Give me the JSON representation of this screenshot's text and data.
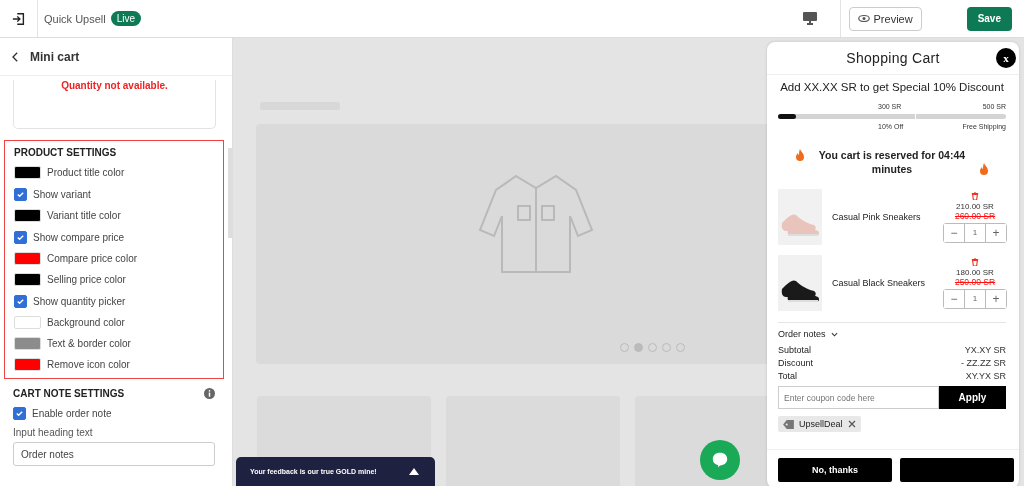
{
  "topbar": {
    "app_name": "Quick Upsell",
    "status_badge": "Live",
    "preview_button": "Preview",
    "save_button": "Save"
  },
  "sidebar": {
    "back_title": "Mini cart",
    "error_preview": "Quantity not available.",
    "product_settings": {
      "heading": "PRODUCT SETTINGS",
      "items": [
        {
          "kind": "color",
          "label": "Product title color",
          "color": "#000000"
        },
        {
          "kind": "checkbox",
          "label": "Show variant",
          "checked": true
        },
        {
          "kind": "color",
          "label": "Variant title color",
          "color": "#000000"
        },
        {
          "kind": "checkbox",
          "label": "Show compare price",
          "checked": true
        },
        {
          "kind": "color",
          "label": "Compare price color",
          "color": "#ff0000"
        },
        {
          "kind": "color",
          "label": "Selling price color",
          "color": "#000000"
        },
        {
          "kind": "checkbox",
          "label": "Show quantity picker",
          "checked": true
        },
        {
          "kind": "color",
          "label": "Background color",
          "color": "#ffffff"
        },
        {
          "kind": "color",
          "label": "Text & border color",
          "color": "#8c8c8c"
        },
        {
          "kind": "color",
          "label": "Remove icon color",
          "color": "#ff0000"
        }
      ]
    },
    "cart_note_settings": {
      "heading": "CART NOTE SETTINGS",
      "enable_label": "Enable order note",
      "enable_checked": true,
      "input_label": "Input heading text",
      "input_value": "Order notes"
    }
  },
  "feedback_bar": {
    "text": "Your feedback is our true GOLD mine!"
  },
  "cart": {
    "title": "Shopping Cart",
    "close": "x",
    "discount_message": "Add XX.XX SR to get Special 10% Discount",
    "progress": {
      "level": 0.08,
      "milestones": [
        {
          "amount": "300 SR",
          "reward": "10% Off"
        },
        {
          "amount": "500 SR",
          "reward": "Free Shipping"
        }
      ]
    },
    "reserved_message": "You cart is reserved for 04:44 minutes",
    "items": [
      {
        "name": "Casual Pink Sneakers",
        "price": "210.00 SR",
        "compare_price": "260.00 SR",
        "quantity": "1",
        "decrease": "−",
        "increase": "+",
        "color": "#e8c4bc"
      },
      {
        "name": "Casual Black Sneakers",
        "price": "180.00 SR",
        "compare_price": "250.00 SR",
        "quantity": "1",
        "decrease": "−",
        "increase": "+",
        "color": "#1a1a1a"
      }
    ],
    "order_notes": "Order notes",
    "totals": [
      {
        "label": "Subtotal",
        "value": "YX.XY SR"
      },
      {
        "label": "Discount",
        "value": "- ZZ.ZZ SR"
      },
      {
        "label": "Total",
        "value": "XY.YX SR"
      }
    ],
    "coupon_placeholder": "Enter coupon code here",
    "apply_button": "Apply",
    "applied_coupon": "UpsellDeal",
    "decline_button": "No, thanks"
  }
}
